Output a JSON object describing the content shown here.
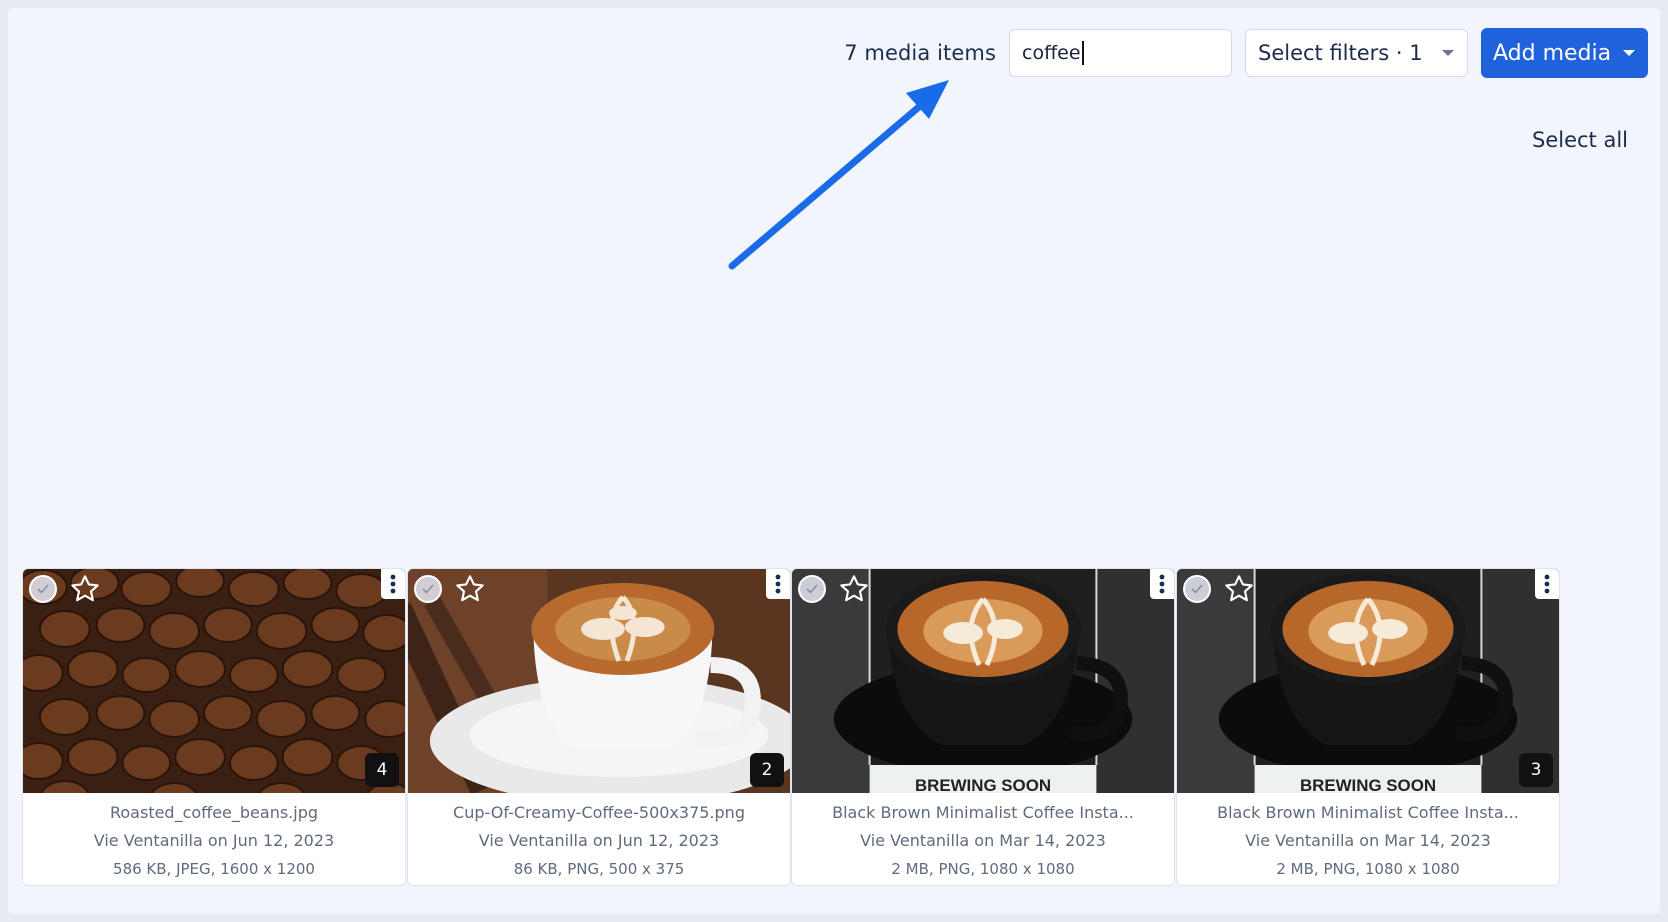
{
  "toolbar": {
    "item_count": "7 media items",
    "search_value": "coffee",
    "filters_label": "Select filters · 1",
    "add_label": "Add media"
  },
  "select_all": "Select all",
  "colors": {
    "accent": "#1f62dc",
    "arrow": "#1a6be8",
    "text": "#1b2d4d"
  },
  "cards": [
    {
      "name": "Roasted_coffee_beans.jpg",
      "author": "Vie Ventanilla on Jun 12, 2023",
      "info": "586 KB, JPEG, 1600 x 1200",
      "badge": "4",
      "image": "coffee-beans"
    },
    {
      "name": "Cup-Of-Creamy-Coffee-500x375.png",
      "author": "Vie Ventanilla on Jun 12, 2023",
      "info": "86 KB, PNG, 500 x 375",
      "badge": "2",
      "image": "white-latte-cup"
    },
    {
      "name": "Black Brown Minimalist Coffee Insta...",
      "author": "Vie Ventanilla on Mar 14, 2023",
      "info": "2 MB, PNG, 1080 x 1080",
      "badge": "",
      "image": "black-latte-cup",
      "caption": "BREWING SOON"
    },
    {
      "name": "Black Brown Minimalist Coffee Insta...",
      "author": "Vie Ventanilla on Mar 14, 2023",
      "info": "2 MB, PNG, 1080 x 1080",
      "badge": "3",
      "image": "black-latte-cup",
      "caption": "BREWING SOON"
    }
  ]
}
